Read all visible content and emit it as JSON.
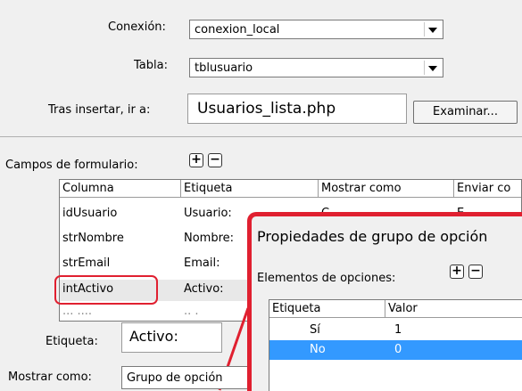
{
  "form": {
    "connection": {
      "label": "Conexión:",
      "value": "conexion_local"
    },
    "table": {
      "label": "Tabla:",
      "value": "tblusuario"
    },
    "after_insert": {
      "label": "Tras insertar, ir a:",
      "value": "Usuarios_lista.php",
      "browse_label": "Examinar..."
    }
  },
  "fields": {
    "label": "Campos de formulario:",
    "columns": [
      "Columna",
      "Etiqueta",
      "Mostrar como",
      "Enviar co"
    ],
    "rows": [
      {
        "column": "idUsuario",
        "label": "Usuario:",
        "display": "C",
        "submit": "E"
      },
      {
        "column": "strNombre",
        "label": "Nombre:",
        "display": "",
        "submit": ""
      },
      {
        "column": "strEmail",
        "label": "Email:",
        "display": "",
        "submit": ""
      },
      {
        "column": "intActivo",
        "label": "Activo:",
        "display": "",
        "submit": ""
      }
    ]
  },
  "detail": {
    "label_caption": "Etiqueta:",
    "label_value": "Activo:",
    "display_caption": "Mostrar como:",
    "display_value": "Grupo de opción"
  },
  "dialog": {
    "title": "Propiedades de grupo de opción",
    "items_label": "Elementos de opciones:",
    "columns": [
      "Etiqueta",
      "Valor"
    ],
    "rows": [
      {
        "label": "Sí",
        "value": "1"
      },
      {
        "label": "No",
        "value": "0"
      }
    ]
  },
  "colors": {
    "highlight": "#e02030",
    "selection": "#3399ff"
  }
}
